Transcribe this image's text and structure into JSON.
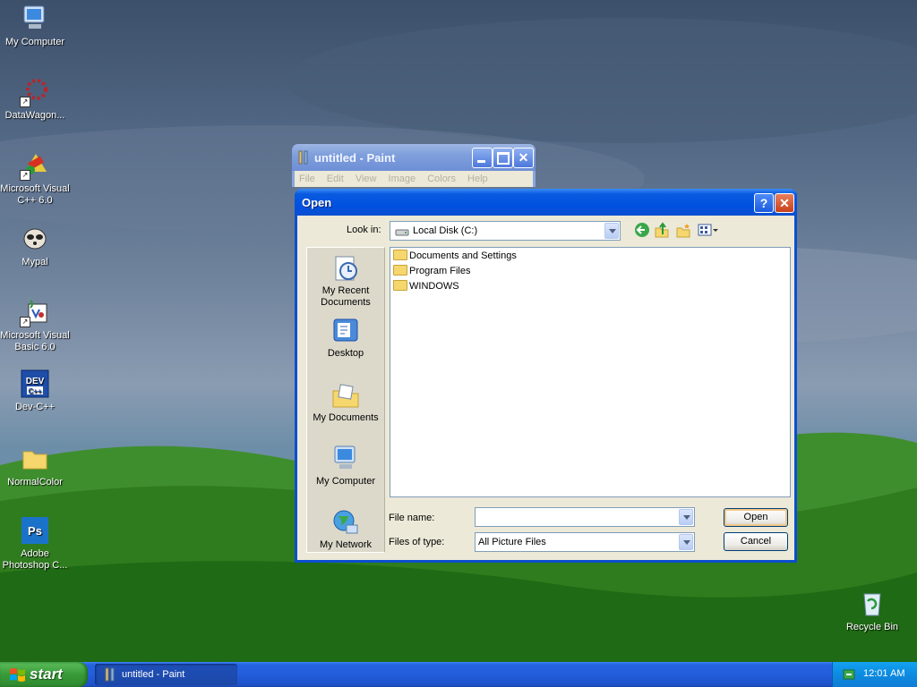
{
  "desktop": {
    "icons": [
      {
        "label": "My Computer"
      },
      {
        "label": "DataWagon..."
      },
      {
        "label": "Microsoft Visual C++ 6.0"
      },
      {
        "label": "Mypal"
      },
      {
        "label": "Microsoft Visual Basic 6.0"
      },
      {
        "label": "Dev-C++"
      },
      {
        "label": "NormalColor"
      },
      {
        "label": "Adobe Photoshop C..."
      },
      {
        "label": "Recycle Bin"
      }
    ]
  },
  "paint_window": {
    "title": "untitled - Paint",
    "menu": [
      "File",
      "Edit",
      "View",
      "Image",
      "Colors",
      "Help"
    ]
  },
  "dialog": {
    "title": "Open",
    "look_in_label": "Look in:",
    "look_in_value": "Local Disk (C:)",
    "places": [
      {
        "label": "My Recent Documents"
      },
      {
        "label": "Desktop"
      },
      {
        "label": "My Documents"
      },
      {
        "label": "My Computer"
      },
      {
        "label": "My Network"
      }
    ],
    "files": [
      "Documents and Settings",
      "Program Files",
      "WINDOWS"
    ],
    "file_name_label": "File name:",
    "file_name_value": "",
    "files_of_type_label": "Files of type:",
    "files_of_type_value": "All Picture Files",
    "open_button": "Open",
    "cancel_button": "Cancel"
  },
  "taskbar": {
    "start_label": "start",
    "task_label": "untitled - Paint",
    "clock": "12:01 AM"
  }
}
